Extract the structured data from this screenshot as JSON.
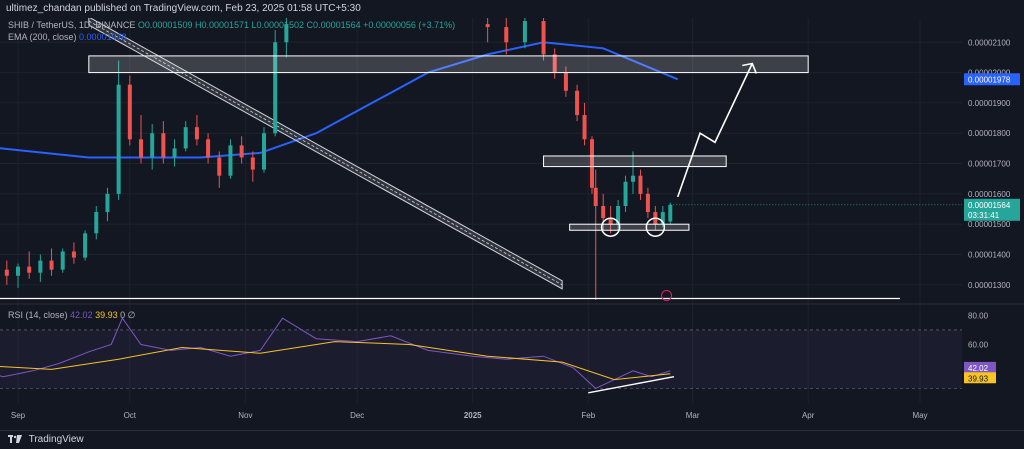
{
  "header": {
    "publish_text": "ultimez_chandan published on TradingView.com, Feb 23, 2025 01:58 UTC+5:30"
  },
  "footer": {
    "brand": "TradingView",
    "logo_icon": "tradingview-logo-icon"
  },
  "legend": {
    "symbol_line": "SHIB / TetherUS, 1D, BINANCE",
    "ohlc_line": "O0.00001509  H0.00001571  L0.00001502  C0.00001564  +0.00000056 (+3.71%)",
    "ema_label": "EMA (200, close)",
    "ema_value": "0.00001978",
    "rsi_label": "RSI (14, close)",
    "rsi_value": "42.02",
    "rsi_ma_value": "39.93",
    "rsi_extra": "0  ∅"
  },
  "colors": {
    "background": "#131722",
    "up": "#26a69a",
    "down": "#ef5350",
    "ema": "#2962ff",
    "rsi": "#7e57c2",
    "rsi_ma": "#f7c325",
    "annotation": "#ffffff"
  },
  "chart_data": [
    {
      "type": "candlestick",
      "title": "SHIB / TetherUS, 1D, BINANCE",
      "y_ticks": [
        "0.00001300",
        "0.00001400",
        "0.00001500",
        "0.00001600",
        "0.00001700",
        "0.00001800",
        "0.00001900",
        "0.00002000",
        "0.00002100"
      ],
      "x_ticks": [
        "Sep",
        "Oct",
        "Nov",
        "Dec",
        "2025",
        "Feb",
        "Mar",
        "Apr",
        "May"
      ],
      "ylim": [
        1.25e-05,
        2.18e-05
      ],
      "price_label": "0.00001564",
      "countdown": "03:31:41",
      "ema_label_value": "0.00001978",
      "ema_200": [
        {
          "x": "2024-08-20",
          "y": 1.76e-05
        },
        {
          "x": "2024-09-20",
          "y": 1.72e-05
        },
        {
          "x": "2024-10-20",
          "y": 1.72e-05
        },
        {
          "x": "2024-11-05",
          "y": 1.735e-05
        },
        {
          "x": "2024-11-20",
          "y": 1.8e-05
        },
        {
          "x": "2024-12-05",
          "y": 1.9e-05
        },
        {
          "x": "2024-12-20",
          "y": 2e-05
        },
        {
          "x": "2025-01-05",
          "y": 2.06e-05
        },
        {
          "x": "2025-01-20",
          "y": 2.1e-05
        },
        {
          "x": "2025-02-05",
          "y": 2.08e-05
        },
        {
          "x": "2025-02-25",
          "y": 1.978e-05
        }
      ],
      "candles": [
        {
          "d": "2024-08-23",
          "o": 1.43e-05,
          "h": 1.46e-05,
          "l": 1.38e-05,
          "c": 1.4e-05
        },
        {
          "d": "2024-08-26",
          "o": 1.4e-05,
          "h": 1.42e-05,
          "l": 1.34e-05,
          "c": 1.35e-05
        },
        {
          "d": "2024-08-29",
          "o": 1.35e-05,
          "h": 1.38e-05,
          "l": 1.3e-05,
          "c": 1.33e-05
        },
        {
          "d": "2024-09-01",
          "o": 1.33e-05,
          "h": 1.37e-05,
          "l": 1.29e-05,
          "c": 1.36e-05
        },
        {
          "d": "2024-09-04",
          "o": 1.36e-05,
          "h": 1.41e-05,
          "l": 1.32e-05,
          "c": 1.34e-05
        },
        {
          "d": "2024-09-07",
          "o": 1.34e-05,
          "h": 1.4e-05,
          "l": 1.31e-05,
          "c": 1.38e-05
        },
        {
          "d": "2024-09-10",
          "o": 1.38e-05,
          "h": 1.42e-05,
          "l": 1.33e-05,
          "c": 1.35e-05
        },
        {
          "d": "2024-09-13",
          "o": 1.35e-05,
          "h": 1.42e-05,
          "l": 1.34e-05,
          "c": 1.41e-05
        },
        {
          "d": "2024-09-16",
          "o": 1.41e-05,
          "h": 1.44e-05,
          "l": 1.37e-05,
          "c": 1.39e-05
        },
        {
          "d": "2024-09-19",
          "o": 1.39e-05,
          "h": 1.48e-05,
          "l": 1.38e-05,
          "c": 1.47e-05
        },
        {
          "d": "2024-09-22",
          "o": 1.47e-05,
          "h": 1.56e-05,
          "l": 1.45e-05,
          "c": 1.54e-05
        },
        {
          "d": "2024-09-25",
          "o": 1.54e-05,
          "h": 1.62e-05,
          "l": 1.51e-05,
          "c": 1.6e-05
        },
        {
          "d": "2024-09-28",
          "o": 1.6e-05,
          "h": 2.04e-05,
          "l": 1.58e-05,
          "c": 1.96e-05
        },
        {
          "d": "2024-10-01",
          "o": 1.96e-05,
          "h": 1.99e-05,
          "l": 1.76e-05,
          "c": 1.78e-05
        },
        {
          "d": "2024-10-04",
          "o": 1.78e-05,
          "h": 1.86e-05,
          "l": 1.7e-05,
          "c": 1.72e-05
        },
        {
          "d": "2024-10-07",
          "o": 1.72e-05,
          "h": 1.83e-05,
          "l": 1.68e-05,
          "c": 1.8e-05
        },
        {
          "d": "2024-10-10",
          "o": 1.8e-05,
          "h": 1.84e-05,
          "l": 1.7e-05,
          "c": 1.72e-05
        },
        {
          "d": "2024-10-13",
          "o": 1.72e-05,
          "h": 1.78e-05,
          "l": 1.69e-05,
          "c": 1.75e-05
        },
        {
          "d": "2024-10-16",
          "o": 1.75e-05,
          "h": 1.84e-05,
          "l": 1.74e-05,
          "c": 1.82e-05
        },
        {
          "d": "2024-10-19",
          "o": 1.82e-05,
          "h": 1.86e-05,
          "l": 1.76e-05,
          "c": 1.78e-05
        },
        {
          "d": "2024-10-22",
          "o": 1.78e-05,
          "h": 1.8e-05,
          "l": 1.7e-05,
          "c": 1.72e-05
        },
        {
          "d": "2024-10-25",
          "o": 1.72e-05,
          "h": 1.74e-05,
          "l": 1.62e-05,
          "c": 1.66e-05
        },
        {
          "d": "2024-10-28",
          "o": 1.66e-05,
          "h": 1.78e-05,
          "l": 1.65e-05,
          "c": 1.76e-05
        },
        {
          "d": "2024-10-31",
          "o": 1.76e-05,
          "h": 1.79e-05,
          "l": 1.7e-05,
          "c": 1.72e-05
        },
        {
          "d": "2024-11-03",
          "o": 1.72e-05,
          "h": 1.74e-05,
          "l": 1.64e-05,
          "c": 1.68e-05
        },
        {
          "d": "2024-11-06",
          "o": 1.68e-05,
          "h": 1.82e-05,
          "l": 1.67e-05,
          "c": 1.8e-05
        },
        {
          "d": "2024-11-09",
          "o": 1.8e-05,
          "h": 2.14e-05,
          "l": 1.79e-05,
          "c": 2.1e-05
        },
        {
          "d": "2024-11-12",
          "o": 2.1e-05,
          "h": 2.18e-05,
          "l": 2.05e-05,
          "c": 2.16e-05
        },
        {
          "d": "2025-01-05",
          "o": 2.16e-05,
          "h": 2.2e-05,
          "l": 2.1e-05,
          "c": 2.15e-05
        },
        {
          "d": "2025-01-10",
          "o": 2.15e-05,
          "h": 2.18e-05,
          "l": 2.06e-05,
          "c": 2.1e-05
        },
        {
          "d": "2025-01-15",
          "o": 2.1e-05,
          "h": 2.19e-05,
          "l": 2.08e-05,
          "c": 2.17e-05
        },
        {
          "d": "2025-01-20",
          "o": 2.17e-05,
          "h": 2.2e-05,
          "l": 2.04e-05,
          "c": 2.06e-05
        },
        {
          "d": "2025-01-23",
          "o": 2.06e-05,
          "h": 2.08e-05,
          "l": 1.98e-05,
          "c": 2e-05
        },
        {
          "d": "2025-01-26",
          "o": 2e-05,
          "h": 2.02e-05,
          "l": 1.92e-05,
          "c": 1.94e-05
        },
        {
          "d": "2025-01-29",
          "o": 1.94e-05,
          "h": 1.96e-05,
          "l": 1.84e-05,
          "c": 1.86e-05
        },
        {
          "d": "2025-01-31",
          "o": 1.86e-05,
          "h": 1.9e-05,
          "l": 1.76e-05,
          "c": 1.78e-05
        },
        {
          "d": "2025-02-02",
          "o": 1.78e-05,
          "h": 1.79e-05,
          "l": 1.6e-05,
          "c": 1.62e-05
        },
        {
          "d": "2025-02-03",
          "o": 1.62e-05,
          "h": 1.68e-05,
          "l": 1.25e-05,
          "c": 1.56e-05
        },
        {
          "d": "2025-02-05",
          "o": 1.56e-05,
          "h": 1.6e-05,
          "l": 1.48e-05,
          "c": 1.52e-05
        },
        {
          "d": "2025-02-07",
          "o": 1.52e-05,
          "h": 1.56e-05,
          "l": 1.47e-05,
          "c": 1.5e-05
        },
        {
          "d": "2025-02-09",
          "o": 1.5e-05,
          "h": 1.58e-05,
          "l": 1.48e-05,
          "c": 1.56e-05
        },
        {
          "d": "2025-02-11",
          "o": 1.56e-05,
          "h": 1.66e-05,
          "l": 1.54e-05,
          "c": 1.64e-05
        },
        {
          "d": "2025-02-13",
          "o": 1.64e-05,
          "h": 1.74e-05,
          "l": 1.6e-05,
          "c": 1.66e-05
        },
        {
          "d": "2025-02-15",
          "o": 1.66e-05,
          "h": 1.68e-05,
          "l": 1.58e-05,
          "c": 1.6e-05
        },
        {
          "d": "2025-02-17",
          "o": 1.6e-05,
          "h": 1.62e-05,
          "l": 1.52e-05,
          "c": 1.54e-05
        },
        {
          "d": "2025-02-19",
          "o": 1.54e-05,
          "h": 1.56e-05,
          "l": 1.48e-05,
          "c": 1.5e-05
        },
        {
          "d": "2025-02-21",
          "o": 1.5e-05,
          "h": 1.56e-05,
          "l": 1.49e-05,
          "c": 1.54e-05
        },
        {
          "d": "2025-02-23",
          "o": 1.509e-05,
          "h": 1.571e-05,
          "l": 1.502e-05,
          "c": 1.564e-05
        }
      ]
    },
    {
      "type": "line",
      "title": "RSI (14, close)",
      "y_ticks": [
        "80.00",
        "60.00"
      ],
      "ylim": [
        20,
        85
      ],
      "rsi_value": "42.02",
      "rsi_ma_value": "39.93",
      "rsi": [
        {
          "x": "2024-08-20",
          "y": 44
        },
        {
          "x": "2024-08-28",
          "y": 38
        },
        {
          "x": "2024-09-05",
          "y": 42
        },
        {
          "x": "2024-09-12",
          "y": 47
        },
        {
          "x": "2024-09-20",
          "y": 55
        },
        {
          "x": "2024-09-26",
          "y": 60
        },
        {
          "x": "2024-09-29",
          "y": 78
        },
        {
          "x": "2024-10-04",
          "y": 60
        },
        {
          "x": "2024-10-12",
          "y": 56
        },
        {
          "x": "2024-10-20",
          "y": 58
        },
        {
          "x": "2024-10-28",
          "y": 52
        },
        {
          "x": "2024-11-05",
          "y": 56
        },
        {
          "x": "2024-11-11",
          "y": 78
        },
        {
          "x": "2024-11-20",
          "y": 64
        },
        {
          "x": "2024-12-01",
          "y": 62
        },
        {
          "x": "2024-12-10",
          "y": 66
        },
        {
          "x": "2024-12-20",
          "y": 56
        },
        {
          "x": "2025-01-01",
          "y": 52
        },
        {
          "x": "2025-01-10",
          "y": 50
        },
        {
          "x": "2025-01-20",
          "y": 52
        },
        {
          "x": "2025-01-28",
          "y": 44
        },
        {
          "x": "2025-02-03",
          "y": 30
        },
        {
          "x": "2025-02-08",
          "y": 36
        },
        {
          "x": "2025-02-13",
          "y": 42
        },
        {
          "x": "2025-02-18",
          "y": 38
        },
        {
          "x": "2025-02-23",
          "y": 42
        }
      ],
      "rsi_ma": [
        {
          "x": "2024-08-20",
          "y": 46
        },
        {
          "x": "2024-09-10",
          "y": 43
        },
        {
          "x": "2024-09-28",
          "y": 50
        },
        {
          "x": "2024-10-15",
          "y": 58
        },
        {
          "x": "2024-11-05",
          "y": 54
        },
        {
          "x": "2024-11-25",
          "y": 62
        },
        {
          "x": "2024-12-15",
          "y": 60
        },
        {
          "x": "2025-01-05",
          "y": 52
        },
        {
          "x": "2025-01-25",
          "y": 48
        },
        {
          "x": "2025-02-08",
          "y": 36
        },
        {
          "x": "2025-02-23",
          "y": 40
        }
      ]
    }
  ]
}
